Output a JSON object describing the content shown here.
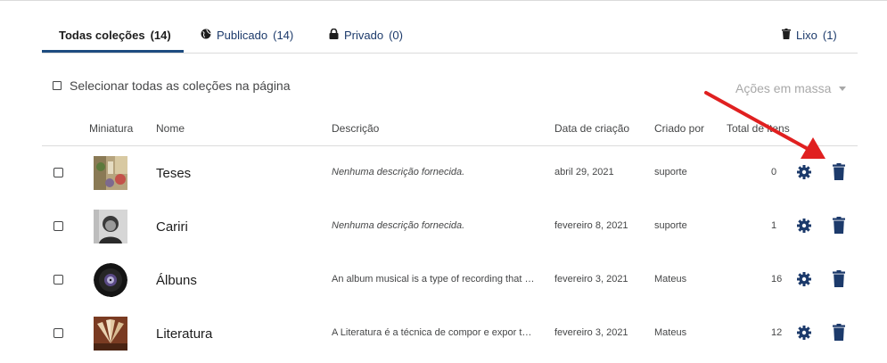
{
  "tabs": [
    {
      "label": "Todas coleções",
      "count": "(14)",
      "icon": "none"
    },
    {
      "label": "Publicado",
      "count": "(14)",
      "icon": "globe-icon"
    },
    {
      "label": "Privado",
      "count": "(0)",
      "icon": "lock-icon"
    },
    {
      "label": "Lixo",
      "count": "(1)",
      "icon": "trash-icon"
    }
  ],
  "select_all_label": "Selecionar todas as coleções na página",
  "bulk_actions_label": "Ações em massa",
  "columns": [
    "Miniatura",
    "Nome",
    "Descrição",
    "Data de criação",
    "Criado por",
    "Total de itens"
  ],
  "rows": [
    {
      "name": "Teses",
      "description": "Nenhuma descrição fornecida.",
      "date": "abril 29, 2021",
      "created_by": "suporte",
      "total": "0"
    },
    {
      "name": "Cariri",
      "description": "Nenhuma descrição fornecida.",
      "date": "fevereiro 8, 2021",
      "created_by": "suporte",
      "total": "1"
    },
    {
      "name": "Álbuns",
      "description": "An album musical is a type of recording that …",
      "date": "fevereiro 3, 2021",
      "created_by": "Mateus",
      "total": "16"
    },
    {
      "name": "Literatura",
      "description": "A Literatura é a técnica de compor e expor te…",
      "date": "fevereiro 3, 2021",
      "created_by": "Mateus",
      "total": "12"
    }
  ],
  "colors": {
    "accent": "#1d4c80",
    "link": "#1c3a6b",
    "annotation_arrow": "#e02020"
  }
}
